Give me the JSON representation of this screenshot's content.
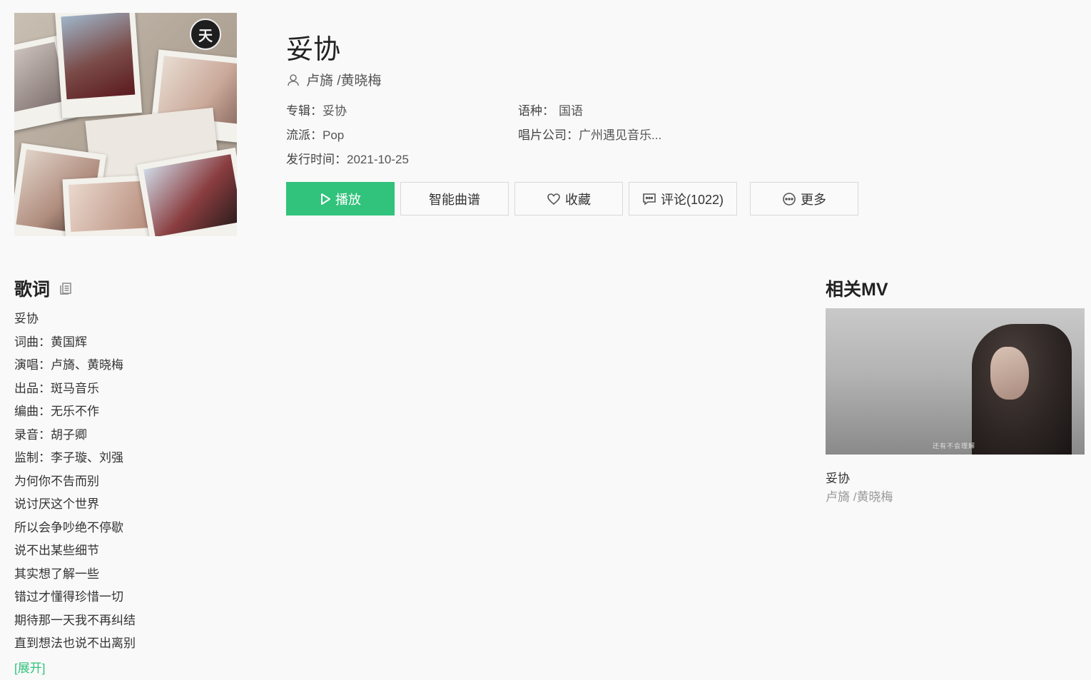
{
  "song": {
    "title": "妥协",
    "artists": "卢旖 /黄晓梅",
    "album_label": "专辑：",
    "album": "妥协",
    "language_label": "语种：",
    "language": "国语",
    "genre_label": "流派：",
    "genre": "Pop",
    "label_label": "唱片公司：",
    "label": "广州遇见音乐...",
    "release_label": "发行时间：",
    "release_date": "2021-10-25",
    "cover_logo_text": "天"
  },
  "actions": {
    "play": "播放",
    "smart_score": "智能曲谱",
    "favorite": "收藏",
    "comments": "评论(1022)",
    "more": "更多"
  },
  "lyrics": {
    "heading": "歌词",
    "lines": [
      "妥协",
      "词曲：黄国辉",
      "演唱：卢旖、黄晓梅",
      "出品：斑马音乐",
      "编曲：无乐不作",
      "录音：胡子卿",
      "监制：李子璇、刘强",
      "为何你不告而别",
      "说讨厌这个世界",
      "所以会争吵绝不停歇",
      "说不出某些细节",
      "其实想了解一些",
      "错过才懂得珍惜一切",
      "期待那一天我不再纠结",
      "直到想法也说不出离别"
    ],
    "expand": "[展开]"
  },
  "mv": {
    "heading": "相关MV",
    "song": "妥协",
    "artists": "卢旖 /黄晓梅",
    "subtitle": "还有不会理解"
  },
  "colors": {
    "accent": "#31c27c",
    "background": "#f9f9f9"
  }
}
